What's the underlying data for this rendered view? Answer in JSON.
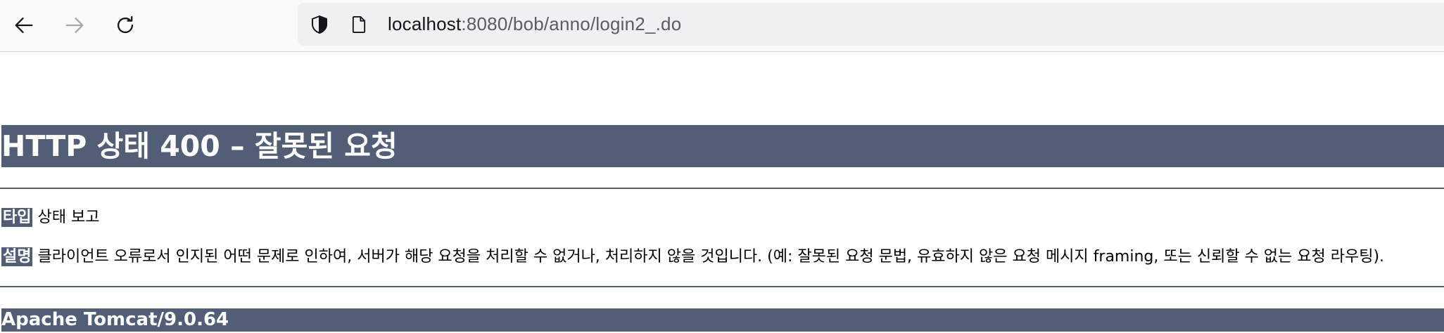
{
  "browser": {
    "url_host": "localhost",
    "url_rest": ":8080/bob/anno/login2_.do",
    "icons": {
      "back": "back-arrow-icon",
      "forward": "forward-arrow-icon",
      "reload": "reload-icon",
      "shield": "shield-icon",
      "page": "page-icon"
    }
  },
  "error_page": {
    "title": "HTTP 상태 400 – 잘못된 요청",
    "type_label": "타입",
    "type_value": "상태 보고",
    "description_label": "설명",
    "description_value": "클라이언트 오류로서 인지된 어떤 문제로 인하여, 서버가 해당 요청을 처리할 수 없거나, 처리하지 않을 것입니다. (예: 잘못된 요청 문법, 유효하지 않은 요청 메시지 framing, 또는 신뢰할 수 없는 요청 라우팅).",
    "server_info": "Apache Tomcat/9.0.64"
  },
  "colors": {
    "accent": "#525d76",
    "toolbar_bg": "#f9f9fb",
    "urlbar_bg": "#f0f0f4"
  }
}
